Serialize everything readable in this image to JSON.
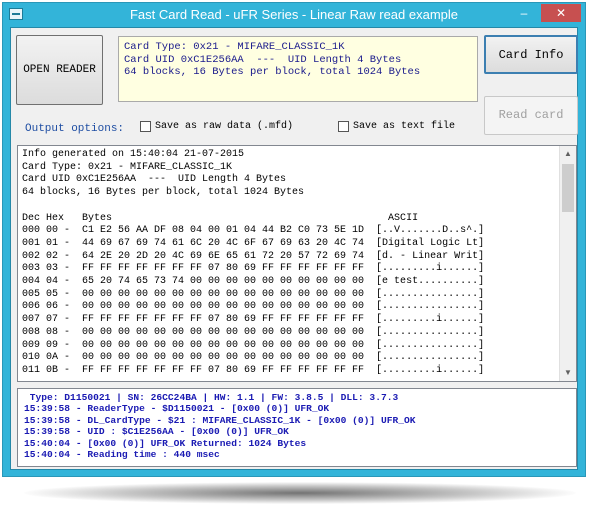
{
  "window": {
    "title": "Fast Card Read - uFR Series - Linear Raw read example",
    "minimize_glyph": "–",
    "close_glyph": "✕"
  },
  "buttons": {
    "open_reader": "OPEN READER",
    "card_info": "Card Info",
    "read_card": "Read card"
  },
  "card_info_box": {
    "lines": [
      "Card Type: 0x21 - MIFARE_CLASSIC_1K",
      "Card UID 0xC1E256AA  ---  UID Length 4 Bytes",
      "64 blocks, 16 Bytes per block, total 1024 Bytes"
    ]
  },
  "output_options": {
    "label": "Output options:",
    "save_raw": {
      "label": "Save as raw data (.mfd)",
      "checked": false
    },
    "save_text": {
      "label": "Save as text file",
      "checked": false
    }
  },
  "main_output": {
    "lines": [
      "Info generated on 15:40:04 21-07-2015",
      "Card Type: 0x21 - MIFARE_CLASSIC_1K",
      "Card UID 0xC1E256AA  ---  UID Length 4 Bytes",
      "64 blocks, 16 Bytes per block, total 1024 Bytes",
      "",
      "Dec Hex   Bytes                                              ASCII",
      "000 00 -  C1 E2 56 AA DF 08 04 00 01 04 44 B2 C0 73 5E 1D  [..V.......D..s^.]",
      "001 01 -  44 69 67 69 74 61 6C 20 4C 6F 67 69 63 20 4C 74  [Digital Logic Lt]",
      "002 02 -  64 2E 20 2D 20 4C 69 6E 65 61 72 20 57 72 69 74  [d. - Linear Writ]",
      "003 03 -  FF FF FF FF FF FF FF 07 80 69 FF FF FF FF FF FF  [.........i......]",
      "004 04 -  65 20 74 65 73 74 00 00 00 00 00 00 00 00 00 00  [e test..........]",
      "005 05 -  00 00 00 00 00 00 00 00 00 00 00 00 00 00 00 00  [................]",
      "006 06 -  00 00 00 00 00 00 00 00 00 00 00 00 00 00 00 00  [................]",
      "007 07 -  FF FF FF FF FF FF FF 07 80 69 FF FF FF FF FF FF  [.........i......]",
      "008 08 -  00 00 00 00 00 00 00 00 00 00 00 00 00 00 00 00  [................]",
      "009 09 -  00 00 00 00 00 00 00 00 00 00 00 00 00 00 00 00  [................]",
      "010 0A -  00 00 00 00 00 00 00 00 00 00 00 00 00 00 00 00  [................]",
      "011 0B -  FF FF FF FF FF FF FF 07 80 69 FF FF FF FF FF FF  [.........i......]"
    ]
  },
  "log": {
    "status_line": " Type: D1150021 | SN: 26CC24BA | HW: 1.1 | FW: 3.8.5 | DLL: 3.7.3",
    "lines": [
      "15:39:58 - ReaderType - $D1150021 - [0x00 (0)] UFR_OK",
      "15:39:58 - DL_CardType - $21 : MIFARE_CLASSIC_1K - [0x00 (0)] UFR_OK",
      "15:39:58 - UID : $C1E256AA - [0x00 (0)] UFR_OK",
      "15:40:04 - [0x00 (0)] UFR_OK Returned: 1024 Bytes",
      "15:40:04 - Reading time : 440 msec"
    ]
  }
}
